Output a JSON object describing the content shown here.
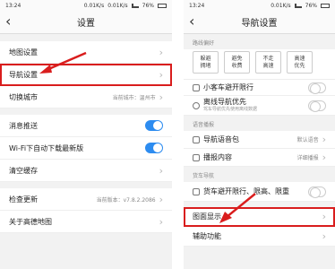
{
  "left": {
    "status": {
      "time": "13:24",
      "net": "0.01K/s",
      "net2": "0.01K/s",
      "battery": "76%"
    },
    "title": "设置",
    "rows": [
      {
        "label": "地图设置"
      },
      {
        "label": "导航设置"
      },
      {
        "label": "切换城市",
        "value": "当前城市：温州市"
      },
      {
        "label": "消息推送"
      },
      {
        "label": "Wi-Fi下自动下载最新版"
      },
      {
        "label": "清空缓存"
      },
      {
        "label": "检查更新",
        "value": "当前版本：v7.8.2.2086"
      },
      {
        "label": "关于高德地图"
      }
    ]
  },
  "right": {
    "status": {
      "time": "13:24",
      "net": "0.01K/s",
      "battery": "76%"
    },
    "title": "导航设置",
    "route_section": "路线偏好",
    "options": [
      "躲避\n拥堵",
      "避免\n收费",
      "不走\n高速",
      "高速\n优先"
    ],
    "rows": [
      {
        "label": "小客车避开限行"
      },
      {
        "label": "离线导航优先",
        "sub": "驾车导航优先使用离线数据"
      },
      {
        "label": "导航语音包",
        "value": "默认语音"
      },
      {
        "label": "播报内容",
        "value": "详细播报"
      },
      {
        "label": "货车避开限行、限高、限重"
      },
      {
        "label": "图面显示"
      },
      {
        "label": "辅助功能"
      }
    ],
    "voice_section": "语音播报",
    "truck_section": "货车导航"
  },
  "colors": {
    "accent": "#2d8cf0",
    "highlight": "#d91d1d"
  }
}
